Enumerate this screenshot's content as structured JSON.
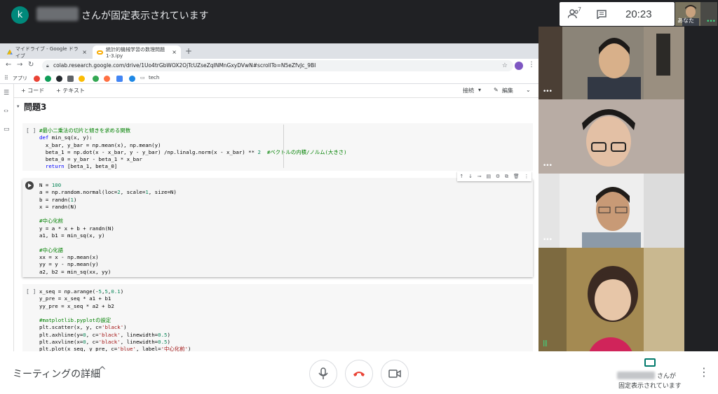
{
  "topbar": {
    "avatar_letter": "k",
    "presenting_text": "さんが固定表示されています",
    "participant_count": "7",
    "time": "20:23",
    "self_label": "あなた",
    "self_dots": "•••"
  },
  "browser": {
    "tabs": [
      {
        "title": "マイドライブ - Google ドライブ",
        "close": "×"
      },
      {
        "title": "統計的機械学習の数理問題1-3.ipy",
        "close": "×"
      }
    ],
    "new_tab": "+",
    "url": "colab.research.google.com/drive/1Uo4trGbWOX2OjTcUZseZqINMnGxyDVwN#scrollTo=N5eZfvJc_9BI",
    "bookmarks": {
      "apps": "アプリ",
      "tech": "tech"
    }
  },
  "colab": {
    "add_code": "+ コード",
    "add_text": "+ テキスト",
    "connect": "接続",
    "edit": "編集",
    "heading": "問題3",
    "cells": [
      {
        "bracket": "[ ]",
        "lines": [
          "#最小二乗法の切片と傾きを求める関数",
          "def min_sq(x, y):",
          "  x_bar, y_bar = np.mean(x), np.mean(y)",
          "  beta_1 = np.dot(x - x_bar, y - y_bar) /np.linalg.norm(x - x_bar) ** 2  #ベクトルの内積/ノルム(大きさ)",
          "  beta_0 = y_bar - beta_1 * x_bar",
          "  return [beta_1, beta_0]"
        ]
      },
      {
        "bracket": "",
        "lines": [
          "N = 100",
          "a = np.random.normal(loc=2, scale=1, size=N)",
          "b = randn(1)",
          "x = randn(N)",
          "",
          "#中心化前",
          "y = a * x + b + randn(N)",
          "a1, b1 = min_sq(x, y)",
          "",
          "#中心化語",
          "xx = x - np.mean(x)",
          "yy = y - np.mean(y)",
          "a2, b2 = min_sq(xx, yy)"
        ]
      },
      {
        "bracket": "[ ]",
        "lines": [
          "x_seq = np.arange(-5,5,0.1)",
          "y_pre = x_seq * a1 + b1",
          "yy_pre = x_seq * a2 + b2",
          "",
          "#matplotlib.pyplotの設定",
          "plt.scatter(x, y, c='black')",
          "plt.axhline(y=0, c='black', linewidth=0.5)",
          "plt.axvline(x=0, c='black', linewidth=0.5)",
          "plt.plot(x_seq, y_pre, c='blue', label='中心化前')"
        ]
      }
    ]
  },
  "bottombar": {
    "meeting_details": "ミーティングの詳細",
    "presenting_line1": "さんが",
    "presenting_line2": "固定表示されています"
  },
  "colors": {
    "meet_dark": "#202124",
    "avatar_teal": "#00897b",
    "hangup_red": "#ea4335",
    "present_teal": "#00796b",
    "comment_green": "#008000",
    "keyword_blue": "#0000ff",
    "number_green": "#098658",
    "string_red": "#a31515"
  },
  "icons": [
    "people-icon",
    "chat-icon",
    "mic-icon",
    "hangup-icon",
    "camera-icon",
    "present-icon",
    "more-vert-icon",
    "chevron-up-icon"
  ]
}
